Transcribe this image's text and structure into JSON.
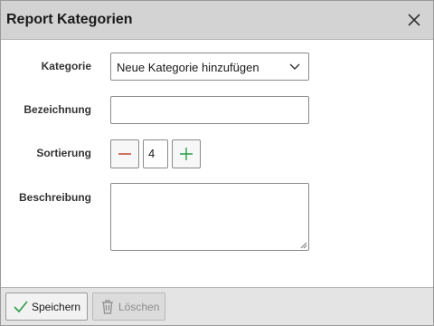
{
  "dialog": {
    "title": "Report Kategorien",
    "close_icon": "close-icon"
  },
  "form": {
    "category": {
      "label": "Kategorie",
      "selected": "Neue Kategorie hinzufügen",
      "icon": "chevron-down-icon"
    },
    "name": {
      "label": "Bezeichnung",
      "value": ""
    },
    "sort": {
      "label": "Sortierung",
      "value": "4",
      "decrement_icon": "minus-icon",
      "increment_icon": "plus-icon"
    },
    "description": {
      "label": "Beschreibung",
      "value": ""
    }
  },
  "footer": {
    "save_label": "Speichern",
    "save_icon": "checkmark-icon",
    "delete_label": "Löschen",
    "delete_icon": "trash-icon",
    "delete_disabled": true
  },
  "colors": {
    "titlebar": "#d3d3d3",
    "footer": "#e4e4e4",
    "minus": "#c0392b",
    "plus": "#27a04a",
    "checkmark": "#2e9c4a"
  }
}
